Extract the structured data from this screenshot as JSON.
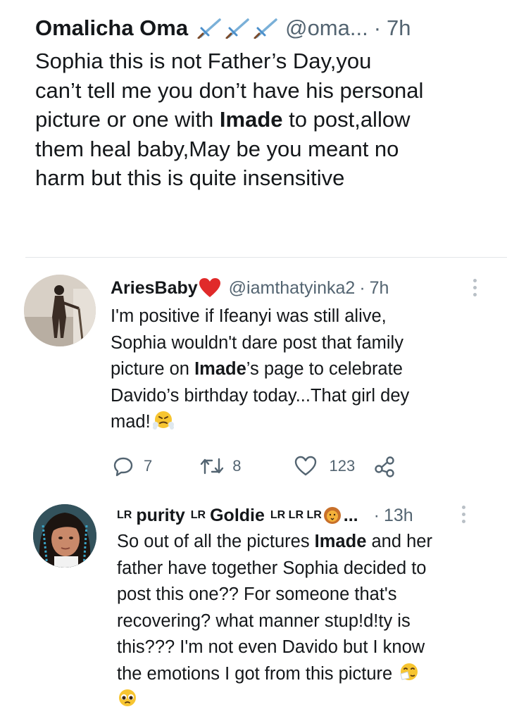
{
  "main_tweet": {
    "author_name": "Omalicha Oma",
    "name_emojis": [
      "sword-icon",
      "sword-icon",
      "sword-icon"
    ],
    "handle": "@oma...",
    "separator": "·",
    "time": "7h",
    "lines": [
      {
        "pre": "Sophia this is not Father’s Day,you",
        "bold": "",
        "post": ""
      },
      {
        "pre": "can’t tell me you don’t have his personal",
        "bold": "",
        "post": ""
      },
      {
        "pre": "picture or one with ",
        "bold": "Imade",
        "post": " to post,allow"
      },
      {
        "pre": "them heal baby,May be you meant no",
        "bold": "",
        "post": ""
      },
      {
        "pre": "harm but this is quite insensitive",
        "bold": "",
        "post": ""
      }
    ]
  },
  "reply1": {
    "author_name": "AriesBaby",
    "name_emoji": "red-heart-icon",
    "handle": "@iamthatyinka2",
    "separator": "·",
    "time": "7h",
    "lines": [
      {
        "pre": "I'm positive if Ifeanyi was still alive,",
        "bold": "",
        "post": ""
      },
      {
        "pre": "Sophia wouldn't dare post that family",
        "bold": "",
        "post": ""
      },
      {
        "pre": "picture on ",
        "bold": "Imade",
        "post": "’s page to celebrate"
      },
      {
        "pre": "Davido’s birthday today...That girl dey",
        "bold": "",
        "post": ""
      },
      {
        "pre": "mad!",
        "bold": "",
        "post": ""
      }
    ],
    "end_emoji": "steam-face-icon",
    "actions": {
      "replies": "7",
      "retweets": "8",
      "likes": "123"
    }
  },
  "reply2": {
    "badge1": "LR",
    "name_part1": "purity",
    "badge2": "LR",
    "name_part2": "Goldie",
    "badge3": "LR LR LR",
    "name_emoji": "lion-icon",
    "truncation": "...",
    "separator": "·",
    "time": "13h",
    "lines": [
      {
        "pre": "So out of all the pictures ",
        "bold": "Imade",
        "post": " and her"
      },
      {
        "pre": "father have together Sophia decided to",
        "bold": "",
        "post": ""
      },
      {
        "pre": "post this one?? For someone that's",
        "bold": "",
        "post": ""
      },
      {
        "pre": "recovering? what manner stup!d!ty is",
        "bold": "",
        "post": ""
      },
      {
        "pre": "this??? I'm not even Davido but I know",
        "bold": "",
        "post": ""
      },
      {
        "pre": "the emotions I got from this picture",
        "bold": "",
        "post": ""
      }
    ],
    "end_emojis": [
      "sneezing-face-icon",
      "pleading-face-icon"
    ]
  }
}
